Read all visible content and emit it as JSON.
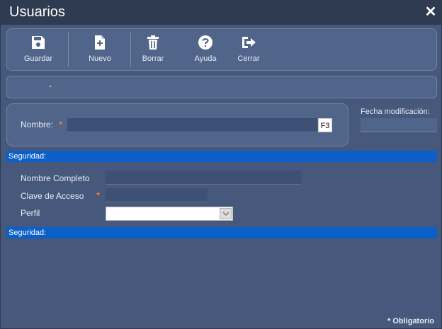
{
  "window": {
    "title": "Usuarios",
    "close_glyph": "✕"
  },
  "toolbar": {
    "items": [
      {
        "label": "Guardar",
        "icon": "save-icon"
      },
      {
        "label": "Nuevo",
        "icon": "new-document-icon"
      },
      {
        "label": "Borrar",
        "icon": "trash-icon"
      },
      {
        "label": "Ayuda",
        "icon": "help-icon"
      },
      {
        "label": "Cerrar",
        "icon": "exit-icon"
      }
    ]
  },
  "infobar": {
    "text": "-"
  },
  "name_section": {
    "label": "Nombre:",
    "required_mark": "*",
    "value": "",
    "lookup_button": "F3"
  },
  "fecha": {
    "label": "Fecha modificación:",
    "value": ""
  },
  "sections": {
    "security_1": "Seguridad:",
    "security_2": "Seguridad:"
  },
  "fields": {
    "full_name_label": "Nombre Completo",
    "full_name_value": "",
    "password_label": "Clave de Acceso",
    "password_required_mark": "*",
    "password_value": "",
    "profile_label": "Perfil",
    "profile_value": ""
  },
  "footer": {
    "required_note": "* Obligatorio"
  },
  "colors": {
    "background": "#46597c",
    "titlebar": "#2f3b50",
    "section_header": "#0a5fc9",
    "required": "#ff8c1a"
  }
}
